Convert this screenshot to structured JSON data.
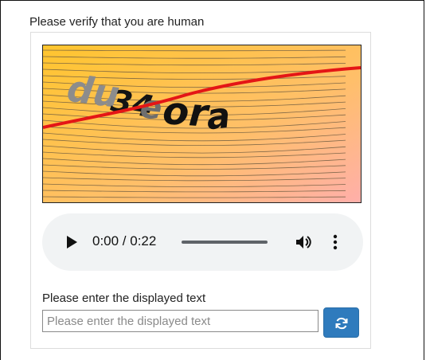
{
  "heading": "Please verify that you are human",
  "captcha": {
    "text": "du34eora",
    "colors": {
      "gradient_start": "#ffc52e",
      "gradient_end": "#ffb0b0",
      "line": "#e41616"
    }
  },
  "audio": {
    "time": "0:00 / 0:22"
  },
  "input": {
    "label": "Please enter the displayed text",
    "placeholder": "Please enter the displayed text",
    "value": ""
  },
  "refresh": {
    "icon": "refresh-icon",
    "color": "#2f7bbd"
  }
}
